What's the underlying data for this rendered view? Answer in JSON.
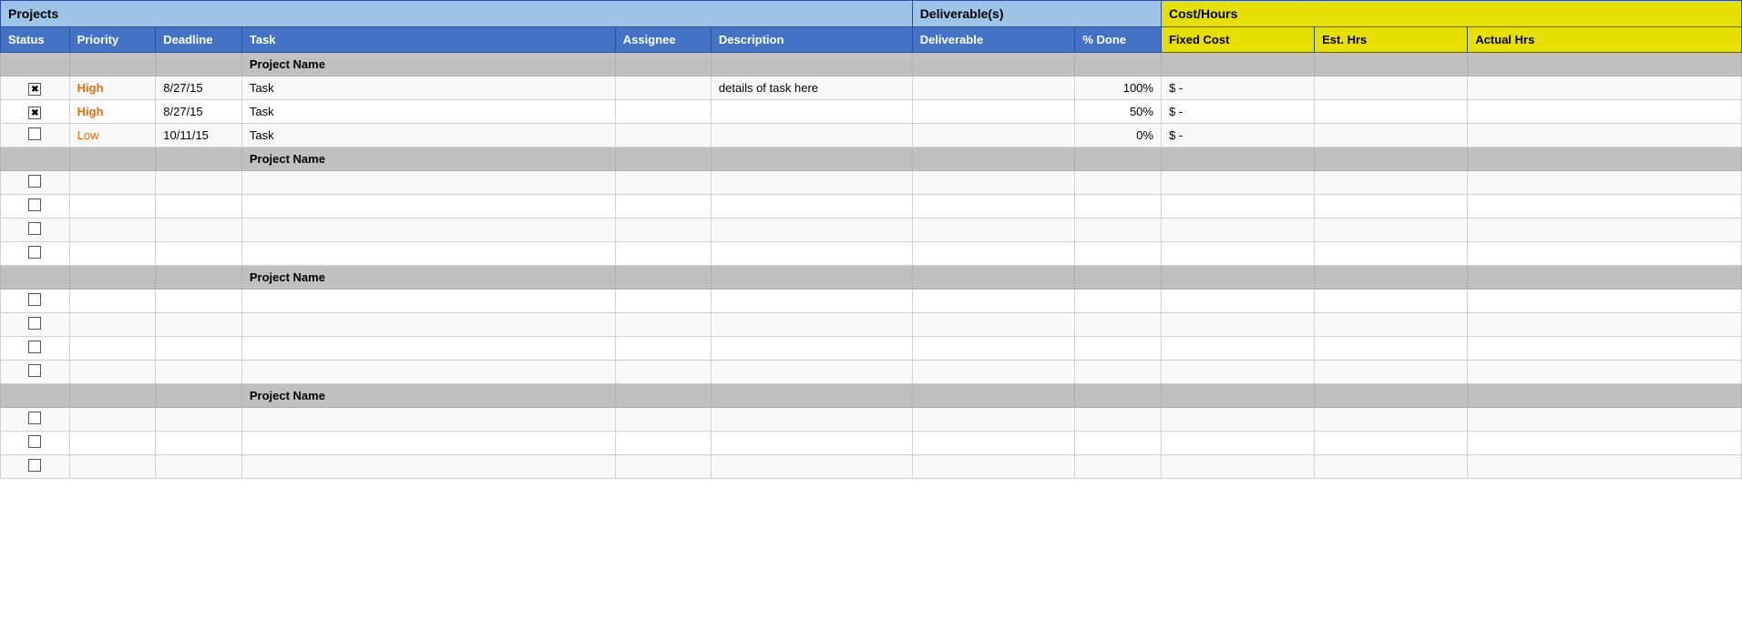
{
  "header": {
    "projects_label": "Projects",
    "deliverables_label": "Deliverable(s)",
    "cost_hours_label": "Cost/Hours"
  },
  "col_headers": {
    "status": "Status",
    "priority": "Priority",
    "deadline": "Deadline",
    "task": "Task",
    "assignee": "Assignee",
    "description": "Description",
    "deliverable": "Deliverable",
    "pct_done": "% Done",
    "fixed_cost": "Fixed Cost",
    "est_hrs": "Est. Hrs",
    "actual_hrs": "Actual Hrs"
  },
  "projects": [
    {
      "name": "Project Name",
      "rows": [
        {
          "status": "x",
          "priority": "High",
          "priority_level": "high",
          "deadline": "8/27/15",
          "task": "Task",
          "assignee": "",
          "description": "details of task here",
          "deliverable": "",
          "pct_done": "100%",
          "fixed_cost": "$        -",
          "est_hrs": "",
          "actual_hrs": ""
        },
        {
          "status": "x",
          "priority": "High",
          "priority_level": "high",
          "deadline": "8/27/15",
          "task": "Task",
          "assignee": "",
          "description": "",
          "deliverable": "",
          "pct_done": "50%",
          "fixed_cost": "$        -",
          "est_hrs": "",
          "actual_hrs": ""
        },
        {
          "status": "empty",
          "priority": "Low",
          "priority_level": "low",
          "deadline": "10/11/15",
          "task": "Task",
          "assignee": "",
          "description": "",
          "deliverable": "",
          "pct_done": "0%",
          "fixed_cost": "$        -",
          "est_hrs": "",
          "actual_hrs": ""
        }
      ]
    },
    {
      "name": "Project Name",
      "rows": [
        {
          "status": "empty",
          "priority": "",
          "priority_level": "",
          "deadline": "",
          "task": "",
          "assignee": "",
          "description": "",
          "deliverable": "",
          "pct_done": "",
          "fixed_cost": "",
          "est_hrs": "",
          "actual_hrs": ""
        },
        {
          "status": "empty",
          "priority": "",
          "priority_level": "",
          "deadline": "",
          "task": "",
          "assignee": "",
          "description": "",
          "deliverable": "",
          "pct_done": "",
          "fixed_cost": "",
          "est_hrs": "",
          "actual_hrs": ""
        },
        {
          "status": "empty",
          "priority": "",
          "priority_level": "",
          "deadline": "",
          "task": "",
          "assignee": "",
          "description": "",
          "deliverable": "",
          "pct_done": "",
          "fixed_cost": "",
          "est_hrs": "",
          "actual_hrs": ""
        },
        {
          "status": "empty",
          "priority": "",
          "priority_level": "",
          "deadline": "",
          "task": "",
          "assignee": "",
          "description": "",
          "deliverable": "",
          "pct_done": "",
          "fixed_cost": "",
          "est_hrs": "",
          "actual_hrs": ""
        }
      ]
    },
    {
      "name": "Project Name",
      "rows": [
        {
          "status": "empty",
          "priority": "",
          "priority_level": "",
          "deadline": "",
          "task": "",
          "assignee": "",
          "description": "",
          "deliverable": "",
          "pct_done": "",
          "fixed_cost": "",
          "est_hrs": "",
          "actual_hrs": ""
        },
        {
          "status": "empty",
          "priority": "",
          "priority_level": "",
          "deadline": "",
          "task": "",
          "assignee": "",
          "description": "",
          "deliverable": "",
          "pct_done": "",
          "fixed_cost": "",
          "est_hrs": "",
          "actual_hrs": ""
        },
        {
          "status": "empty",
          "priority": "",
          "priority_level": "",
          "deadline": "",
          "task": "",
          "assignee": "",
          "description": "",
          "deliverable": "",
          "pct_done": "",
          "fixed_cost": "",
          "est_hrs": "",
          "actual_hrs": ""
        },
        {
          "status": "empty",
          "priority": "",
          "priority_level": "",
          "deadline": "",
          "task": "",
          "assignee": "",
          "description": "",
          "deliverable": "",
          "pct_done": "",
          "fixed_cost": "",
          "est_hrs": "",
          "actual_hrs": ""
        }
      ]
    },
    {
      "name": "Project Name",
      "rows": [
        {
          "status": "empty",
          "priority": "",
          "priority_level": "",
          "deadline": "",
          "task": "",
          "assignee": "",
          "description": "",
          "deliverable": "",
          "pct_done": "",
          "fixed_cost": "",
          "est_hrs": "",
          "actual_hrs": ""
        },
        {
          "status": "empty",
          "priority": "",
          "priority_level": "",
          "deadline": "",
          "task": "",
          "assignee": "",
          "description": "",
          "deliverable": "",
          "pct_done": "",
          "fixed_cost": "",
          "est_hrs": "",
          "actual_hrs": ""
        },
        {
          "status": "empty",
          "priority": "",
          "priority_level": "",
          "deadline": "",
          "task": "",
          "assignee": "",
          "description": "",
          "deliverable": "",
          "pct_done": "",
          "fixed_cost": "",
          "est_hrs": "",
          "actual_hrs": ""
        }
      ]
    }
  ]
}
